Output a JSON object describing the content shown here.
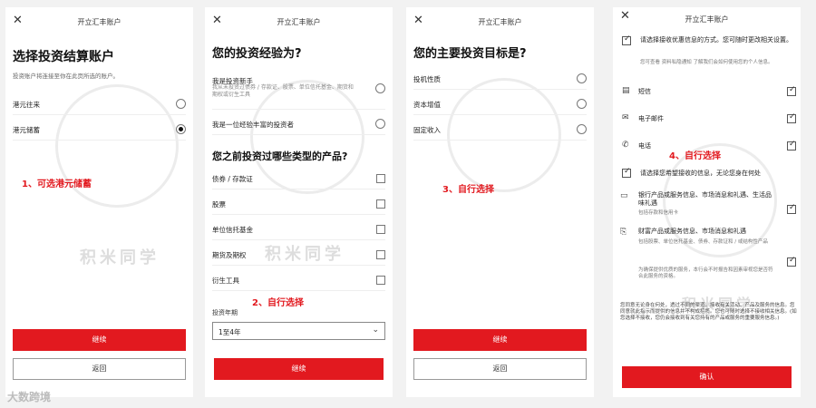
{
  "header_title": "开立汇丰账户",
  "icons": {
    "close": "close-icon"
  },
  "panel1": {
    "heading": "选择投资结算账户",
    "subtitle": "投资账户将连接至你在此页所选的账户。",
    "options": [
      {
        "label": "港元往来",
        "selected": false
      },
      {
        "label": "港元储蓄",
        "selected": true
      }
    ],
    "note": "1、可选港元储蓄",
    "continue": "继续",
    "back": "返回",
    "watermark": "积米同学"
  },
  "panel2": {
    "heading": "您的投资经验为?",
    "experience": [
      {
        "label": "我是投资新手",
        "desc": "我从未投资过债券 / 存款证、股票、单位信托基金、期货和期权或衍生工具"
      },
      {
        "label": "我是一位经验丰富的投资者",
        "desc": ""
      }
    ],
    "products_heading": "您之前投资过哪些类型的产品?",
    "products": [
      "债券 / 存款证",
      "股票",
      "单位信托基金",
      "期货及期权",
      "衍生工具"
    ],
    "note": "2、自行选择",
    "years_label": "投资年期",
    "years_value": "1至4年",
    "continue": "继续",
    "watermark": "积米同学"
  },
  "panel3": {
    "heading": "您的主要投资目标是?",
    "goals": [
      "投机性质",
      "资本增值",
      "固定收入"
    ],
    "note": "3、自行选择",
    "continue": "继续",
    "back": "返回"
  },
  "panel4": {
    "intro": "请选择接收优惠信息的方式。您可随时更改相关设置。",
    "intro_small": "您可查看 资料私隐通知  了解我们会如何使用您的个人信息。",
    "channels": [
      "短信",
      "电子邮件",
      "电话"
    ],
    "note": "4、自行选择",
    "info_label": "请选择您希望接收的信息，无论您身在何处",
    "cat1_title": "银行产品或服务信息、市场消息和礼遇、生活品味礼遇",
    "cat1_small": "包括存款和信用卡",
    "cat2_title": "财富产品或服务信息、市场消息和礼遇",
    "cat2_small": "包括股票、单位信托基金、债券、存款证和 / 或结构性产品",
    "cat2_note": "为确保提供优质的服务，本行会不时报告和因素审视您是否符合此服务的资格。",
    "terms": "您同意无论身在何处，透过不同的渠道，接收有关活动、产品及服务的信息。您同意就此指示而提供的信息并不构成招揽。您也可随时选择不接收相关信息。(如您选择不接收，您仍会接收到有关您持有的产品或服务的重要服务信息。)",
    "confirm": "确认",
    "watermark": "积米同学"
  },
  "brand": "大数跨境"
}
